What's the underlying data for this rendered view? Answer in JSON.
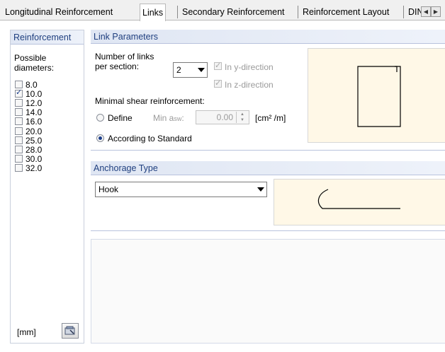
{
  "tabs": [
    {
      "label": "Longitudinal Reinforcement",
      "active": false
    },
    {
      "label": "Links",
      "active": true
    },
    {
      "label": "Secondary Reinforcement",
      "active": false
    },
    {
      "label": "Reinforcement Layout",
      "active": false
    },
    {
      "label": "DIN",
      "active": false
    }
  ],
  "reinforcement": {
    "header": "Reinforcement",
    "possible_label": "Possible",
    "diameters_label": "diameters:",
    "diameters": [
      {
        "value": "8.0",
        "checked": false
      },
      {
        "value": "10.0",
        "checked": true
      },
      {
        "value": "12.0",
        "checked": false
      },
      {
        "value": "14.0",
        "checked": false
      },
      {
        "value": "16.0",
        "checked": false
      },
      {
        "value": "20.0",
        "checked": false
      },
      {
        "value": "25.0",
        "checked": false
      },
      {
        "value": "28.0",
        "checked": false
      },
      {
        "value": "30.0",
        "checked": false
      },
      {
        "value": "32.0",
        "checked": false
      }
    ],
    "unit": "[mm]"
  },
  "link_params": {
    "header": "Link Parameters",
    "num_links_line1": "Number of links",
    "num_links_line2": "per section:",
    "num_links_value": "2",
    "y_direction": {
      "label": "In y-direction",
      "checked": true,
      "enabled": false
    },
    "z_direction": {
      "label": "In z-direction",
      "checked": true,
      "enabled": false
    },
    "minimal_shear": "Minimal shear reinforcement:",
    "define_label": "Define",
    "min_asw_label": "Min a",
    "min_asw_sub": "sw",
    "min_asw_colon": ":",
    "min_asw_value": "0.00",
    "min_asw_unit": "[cm² /m]",
    "according_label": "According to Standard",
    "selected_option": "According to Standard"
  },
  "anchorage": {
    "header": "Anchorage Type",
    "value": "Hook"
  },
  "colors": {
    "header_text": "#1f3f7f",
    "preview_bg": "#fff8e7",
    "radio_checked": "#1b3d8a"
  },
  "icons": [
    "scroll-left-icon",
    "scroll-right-icon",
    "edit-diameters-icon",
    "dropdown-arrow-icon",
    "spinner-up-icon",
    "spinner-down-icon"
  ]
}
